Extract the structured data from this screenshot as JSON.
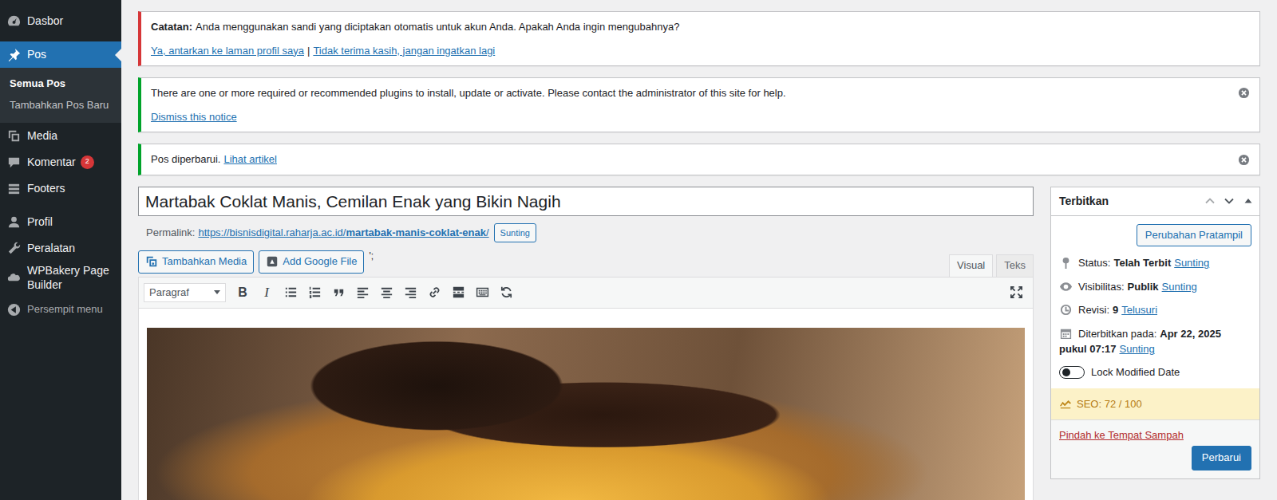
{
  "sidebar": {
    "groups": [
      {
        "items": [
          {
            "label": "Dasbor",
            "selected": false
          }
        ]
      },
      {
        "items": [
          {
            "label": "Pos",
            "selected": true,
            "submenu": [
              {
                "label": "Semua Pos",
                "selected": true
              },
              {
                "label": "Tambahkan Pos Baru",
                "selected": false
              }
            ]
          },
          {
            "label": "Media",
            "selected": false
          },
          {
            "label": "Komentar",
            "selected": false,
            "badge": "2"
          },
          {
            "label": "Footers",
            "selected": false
          }
        ]
      },
      {
        "items": [
          {
            "label": "Profil",
            "selected": false
          },
          {
            "label": "Peralatan",
            "selected": false
          },
          {
            "label": "WPBakery Page Builder",
            "selected": false
          }
        ]
      }
    ],
    "collapse": "Persempit menu"
  },
  "notices": [
    {
      "kind": "stacked",
      "color": "#d63638",
      "strong": "Catatan:",
      "text": "Anda menggunakan sandi yang diciptakan otomatis untuk akun Anda. Apakah Anda ingin mengubahnya?",
      "links": [
        "Ya, antarkan ke laman profil saya",
        "Tidak terima kasih, jangan ingatkan lagi"
      ],
      "separator": "|",
      "dismissible": false
    },
    {
      "kind": "stacked",
      "color": "#00a32a",
      "text": "There are one or more required or recommended plugins to install, update or activate. Please contact the administrator of this site for help.",
      "links": [
        "Dismiss this notice"
      ],
      "dismissible": true
    },
    {
      "kind": "inline",
      "color": "#00a32a",
      "text": "Pos diperbarui.",
      "links": [
        "Lihat artikel"
      ],
      "dismissible": true
    }
  ],
  "editor": {
    "title": "Martabak Coklat Manis, Cemilan Enak yang Bikin Nagih",
    "permalink": {
      "label": "Permalink:",
      "base": "https://bisnisdigital.raharja.ac.id/",
      "slug": "martabak-manis-coklat-enak",
      "trail": "/",
      "button": "Sunting"
    },
    "media_buttons": [
      "Tambahkan Media",
      "Add Google File"
    ],
    "stray_text": "';",
    "tabs": [
      {
        "label": "Visual",
        "selected": true
      },
      {
        "label": "Teks",
        "selected": false
      }
    ],
    "toolbar": {
      "format": "Paragraf",
      "glyphs": [
        "B",
        "I"
      ]
    }
  },
  "publish": {
    "title": "Terbitkan",
    "preview": "Perubahan Pratampil",
    "rows": [
      {
        "label": "Status:",
        "value": "Telah Terbit",
        "link": "Sunting"
      },
      {
        "label": "Visibilitas:",
        "value": "Publik",
        "link": "Sunting"
      },
      {
        "label": "Revisi:",
        "value": "9",
        "link": "Telusuri"
      },
      {
        "label": "Diterbitkan pada:",
        "value": "Apr 22, 2025 pukul 07:17",
        "link": "Sunting"
      }
    ],
    "lock": {
      "label": "Lock Modified Date",
      "on": false
    },
    "seo": "SEO: 72 / 100",
    "trash": "Pindah ke Tempat Sampah",
    "update": "Perbarui"
  }
}
